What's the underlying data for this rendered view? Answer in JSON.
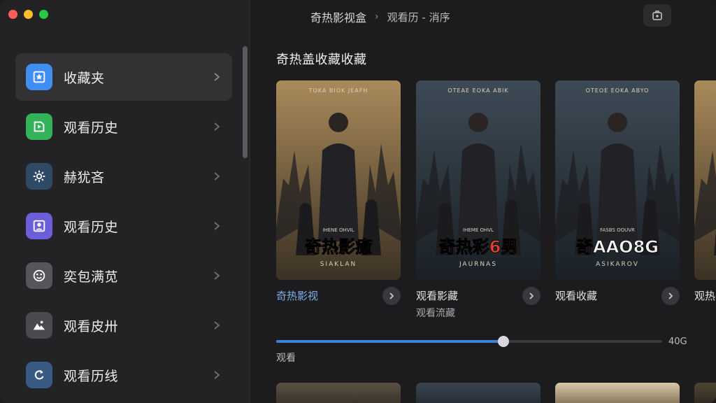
{
  "header": {
    "app_title": "奇热影视盒",
    "separator": "›",
    "page": "观看历 - 消序"
  },
  "sidebar": {
    "items": [
      {
        "label": "收藏夹",
        "icon": "star-folder-icon",
        "color": "#3f8ef0",
        "active": true
      },
      {
        "label": "观看历史",
        "icon": "play-history-icon",
        "color": "#34b25a",
        "active": false
      },
      {
        "label": "赫犹吝",
        "icon": "gear-icon",
        "color": "#2f4a66",
        "active": false
      },
      {
        "label": "观看历史",
        "icon": "profile-icon",
        "color": "#6a5fd8",
        "active": false
      },
      {
        "label": "奕包满苋",
        "icon": "face-icon",
        "color": "#55555a",
        "active": false
      },
      {
        "label": "观看皮卅",
        "icon": "mountain-icon",
        "color": "#4a4a4f",
        "active": false
      },
      {
        "label": "观看历线",
        "icon": "refresh-icon",
        "color": "#3a5a86",
        "active": false
      }
    ]
  },
  "main": {
    "section_title": "奇热盖收藏收藏",
    "cards": [
      {
        "title": "奇热影视",
        "subtitle": "",
        "link": true,
        "poster_top_text": "TOKA BIOK JEAFH",
        "poster_title": "奇热影癒",
        "poster_title_color": "#e7b04a",
        "poster_sub": "SIAKLAN",
        "poster_tag": "IHENE OHVIL",
        "tone": "warm"
      },
      {
        "title": "观看影藏",
        "subtitle": "观看流藏",
        "link": false,
        "poster_top_text": "OTEAE EOKA ABIK",
        "poster_title": "奇热彩6男",
        "poster_title_color": "#e0402e",
        "poster_sub": "JAURNAS",
        "poster_tag": "IHEME OHVL",
        "tone": "cold"
      },
      {
        "title": "观看收藏",
        "subtitle": "",
        "link": false,
        "poster_top_text": "OTEOE EOKA ABYO",
        "poster_title": "奇AAO8G",
        "poster_title_color": "#f2f2f2",
        "poster_sub": "ASIKAROV",
        "poster_tag": "FASBS OOUVR",
        "tone": "cold"
      },
      {
        "title": "观热",
        "subtitle": "",
        "link": false,
        "poster_top_text": "",
        "poster_title": "",
        "poster_title_color": "#e7b04a",
        "poster_sub": "",
        "poster_tag": "",
        "tone": "warm"
      }
    ]
  },
  "progress": {
    "value": 0.58,
    "value_label": "40G",
    "label": "观看"
  },
  "colors": {
    "accent": "#3e82d4",
    "link": "#7fb0e8"
  }
}
